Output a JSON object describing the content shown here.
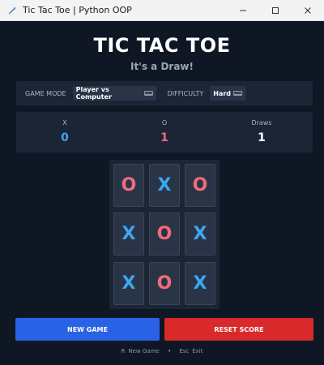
{
  "window": {
    "title": "Tic Tac Toe | Python OOP"
  },
  "app": {
    "title": "TIC TAC TOE",
    "status": "It's a Draw!"
  },
  "settings": {
    "mode_label": "GAME MODE",
    "mode_value": "Player vs Computer",
    "difficulty_label": "DIFFICULTY",
    "difficulty_value": "Hard"
  },
  "score": {
    "x_label": "X",
    "x_value": "0",
    "o_label": "O",
    "o_value": "1",
    "draws_label": "Draws",
    "draws_value": "1"
  },
  "board": {
    "cells": [
      "O",
      "X",
      "O",
      "X",
      "O",
      "X",
      "X",
      "O",
      "X"
    ]
  },
  "buttons": {
    "new_game": "NEW GAME",
    "reset_score": "RESET SCORE"
  },
  "footer": {
    "new_key": "R",
    "new_label": "New Game",
    "separator": "•",
    "exit_key": "Esc",
    "exit_label": "Exit"
  },
  "colors": {
    "x_color": "#3ea6f0",
    "o_color": "#f06b7a",
    "background": "#0f1724",
    "panel": "#1b2535",
    "cell": "#2a3447",
    "new_game_button": "#2a62e6",
    "reset_button": "#d82a2a"
  }
}
